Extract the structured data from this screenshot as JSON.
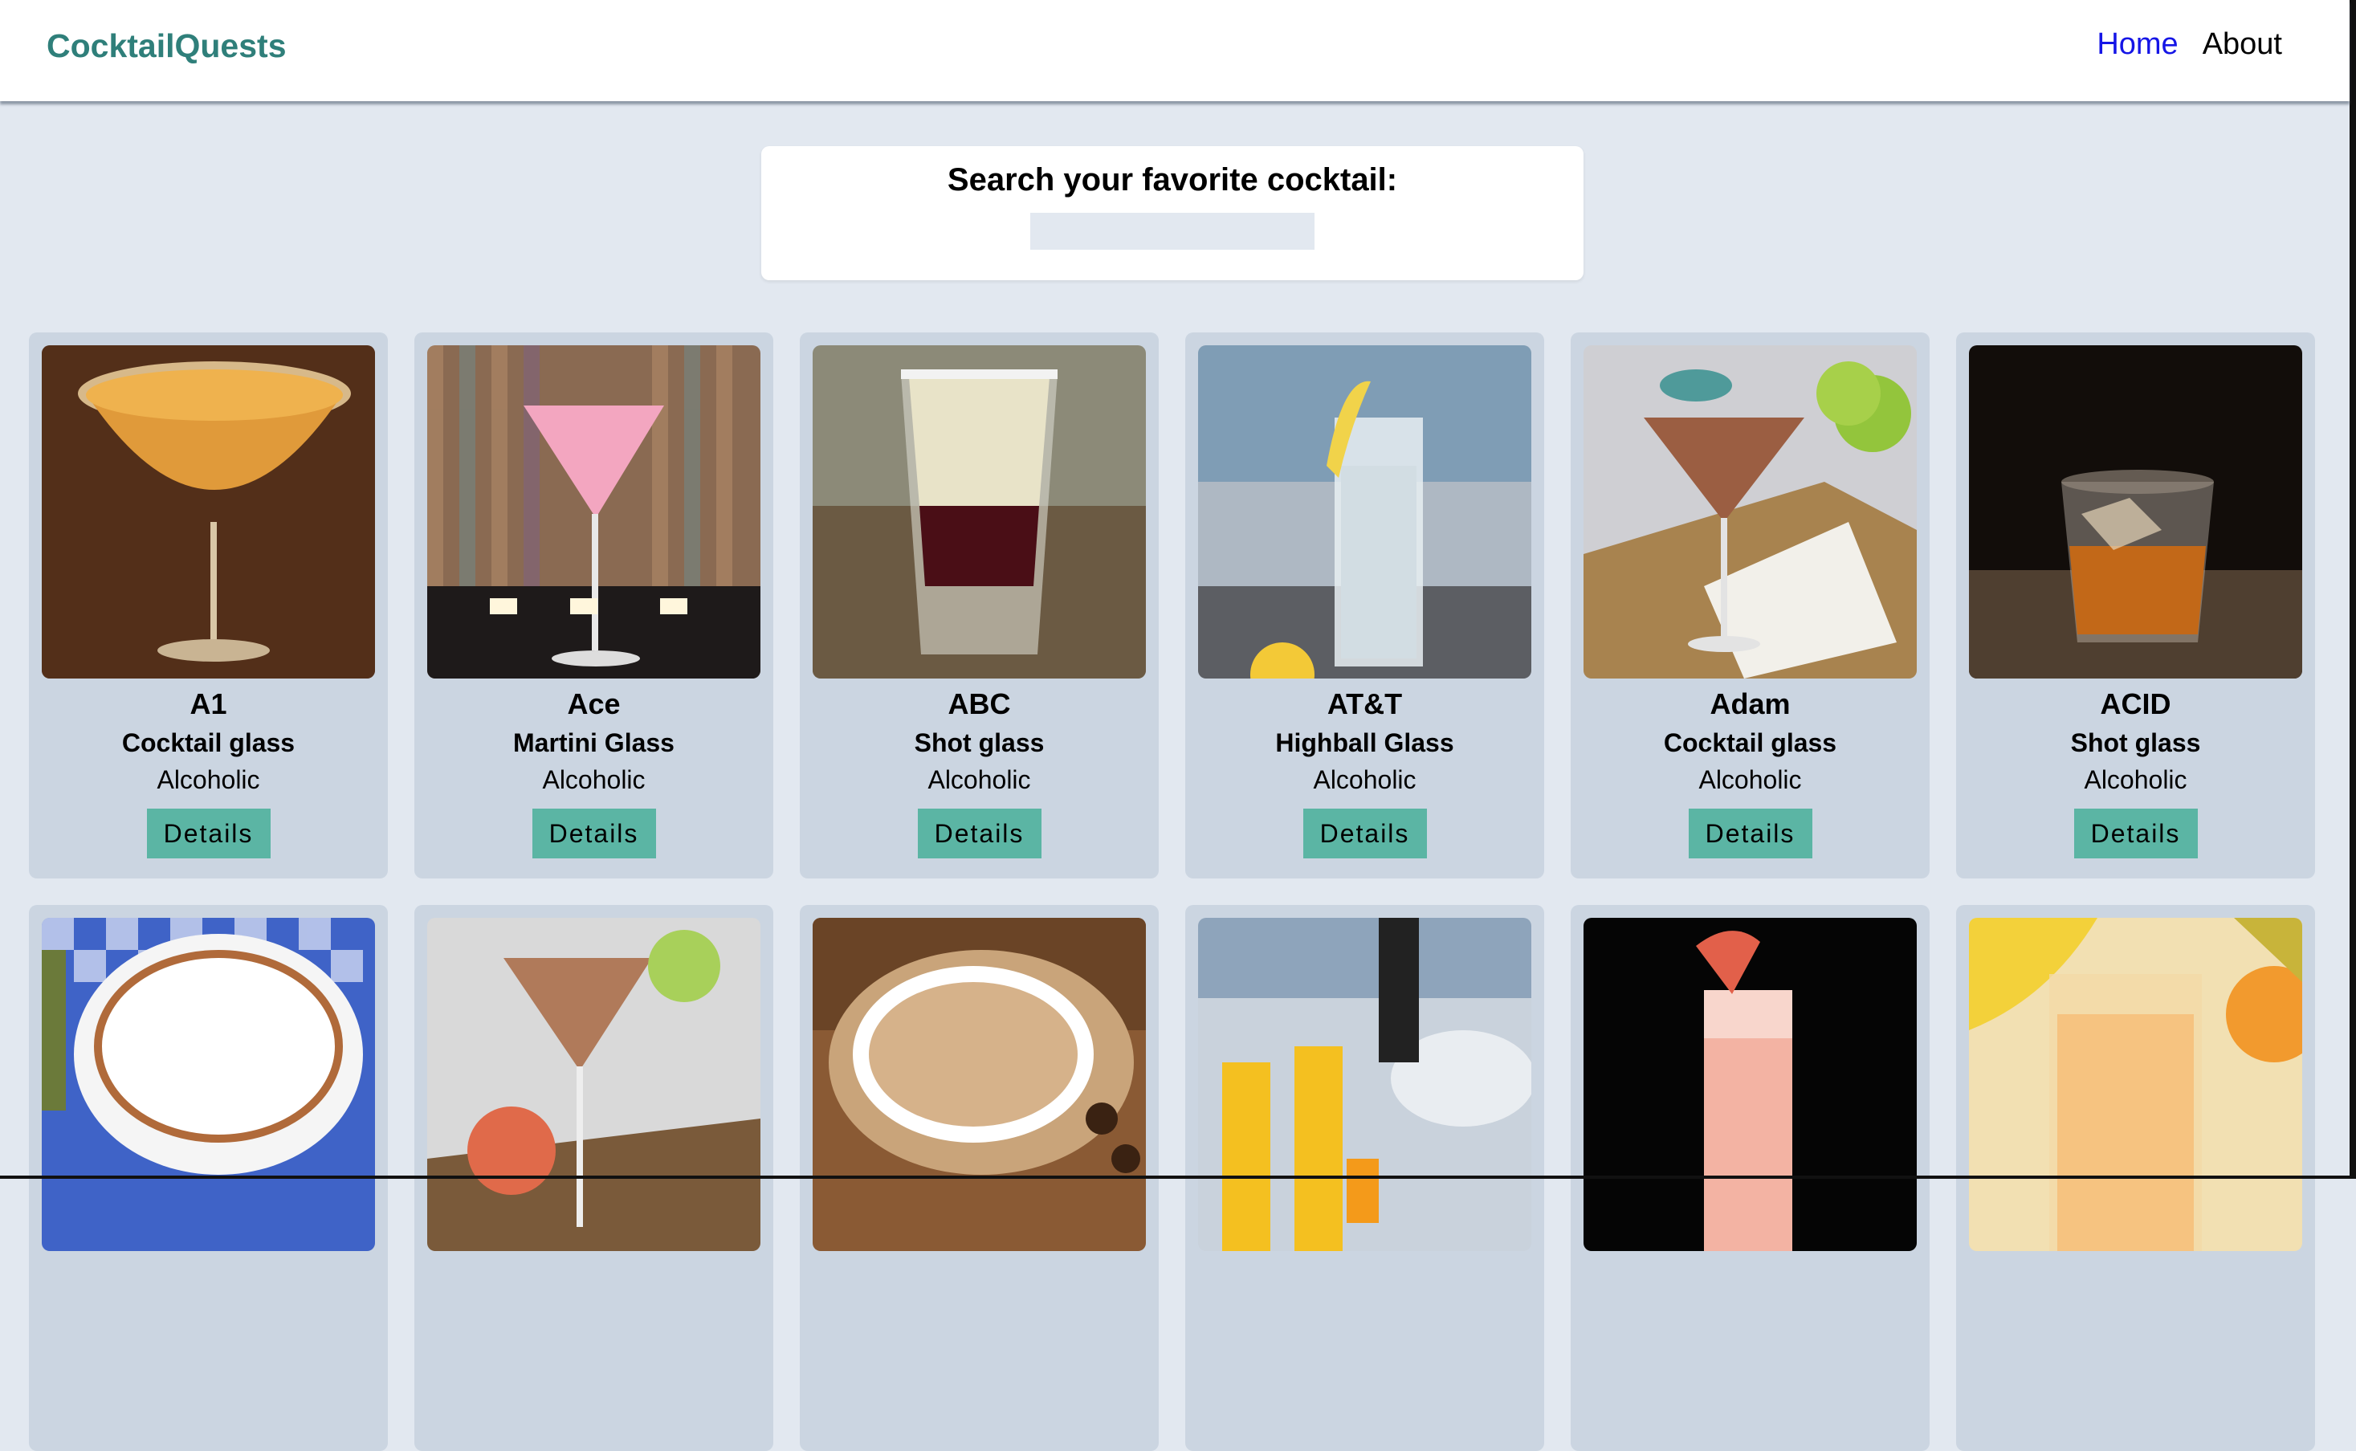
{
  "nav": {
    "brand": "CocktailQuests",
    "links": [
      {
        "label": "Home",
        "active": true
      },
      {
        "label": "About",
        "active": false
      }
    ]
  },
  "search": {
    "label": "Search your favorite cocktail:",
    "value": "",
    "placeholder": ""
  },
  "cards": [
    {
      "name": "A1",
      "glass": "Cocktail glass",
      "type": "Alcoholic",
      "button": "Details",
      "image": "orange-martini-sugar-rim"
    },
    {
      "name": "Ace",
      "glass": "Martini Glass",
      "type": "Alcoholic",
      "button": "Details",
      "image": "pink-martini-candles"
    },
    {
      "name": "ABC",
      "glass": "Shot glass",
      "type": "Alcoholic",
      "button": "Details",
      "image": "layered-shot"
    },
    {
      "name": "AT&T",
      "glass": "Highball Glass",
      "type": "Alcoholic",
      "button": "Details",
      "image": "clear-highball-lemon"
    },
    {
      "name": "Adam",
      "glass": "Cocktail glass",
      "type": "Alcoholic",
      "button": "Details",
      "image": "martini-lime-umbrella"
    },
    {
      "name": "ACID",
      "glass": "Shot glass",
      "type": "Alcoholic",
      "button": "Details",
      "image": "whiskey-rocks"
    },
    {
      "image": "cappuccino-checkered"
    },
    {
      "image": "martini-lime-grapefruit"
    },
    {
      "image": "latte-coffee-beans"
    },
    {
      "image": "mimosa-champagne"
    },
    {
      "image": "grapefruit-highball-dark"
    },
    {
      "image": "orange-juice-glass"
    }
  ]
}
